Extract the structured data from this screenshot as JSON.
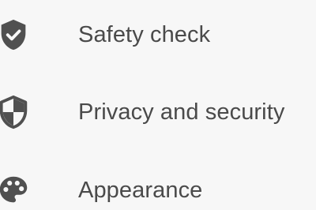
{
  "menu": {
    "items": [
      {
        "label": "Safety check",
        "icon": "shield-check-icon"
      },
      {
        "label": "Privacy and security",
        "icon": "shield-half-icon"
      },
      {
        "label": "Appearance",
        "icon": "palette-icon"
      }
    ]
  },
  "colors": {
    "background": "#f7f7f7",
    "text": "#4a4a4a",
    "icon": "#505050"
  }
}
